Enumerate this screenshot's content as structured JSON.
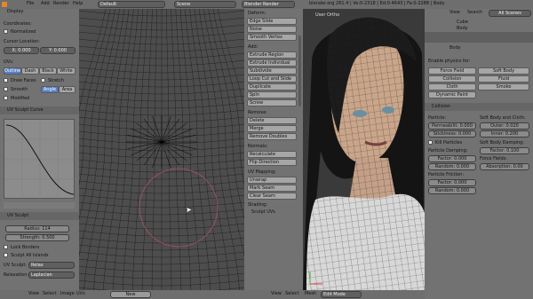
{
  "topbar": {
    "menus": [
      "File",
      "Add",
      "Render",
      "Help"
    ],
    "layout": "Default",
    "scene": "Scene",
    "engine": "Blender Render",
    "info": "blender.org 261.4 | Ve:0-2318 | Ed:0-4643 | Fa:0-2288 | Body"
  },
  "uv_editor": {
    "panel_title": "Display",
    "coordinates_label": "Coordinates:",
    "normalized_label": "Normalized",
    "cursor_location_label": "Cursor Location:",
    "cursor_x": "X: 0.000",
    "cursor_y": "Y: 0.000",
    "uvs_label": "UVs:",
    "uv_styles": [
      "Outline",
      "Dash",
      "Black",
      "White"
    ],
    "draw_faces_label": "Draw Faces",
    "stretch_label": "Stretch",
    "smooth_label": "Smooth",
    "angle_label": "Angle",
    "area_label": "Area",
    "modified_label": "Modified",
    "sculpt_curve_title": "UV Sculpt Curve",
    "uv_sculpt_title": "UV Sculpt",
    "radius_label": "Radius: 114",
    "strength_label": "Strength: 0.500",
    "lock_borders_label": "Lock Borders",
    "sculpt_all_islands_label": "Sculpt All Islands",
    "uv_sculpt_tool_label": "UV Sculpt:",
    "uv_sculpt_tool_value": "Relax",
    "relaxation_label": "Relaxation:",
    "relaxation_value": "Laplacian",
    "footer_menus": [
      "View",
      "Select",
      "Image",
      "UVs"
    ],
    "image_name": "New"
  },
  "tools": {
    "deform_title": "Deform:",
    "deform": [
      "Edge Slide",
      "Noise",
      "Smooth Vertex"
    ],
    "add_title": "Add:",
    "add": [
      "Extrude Region",
      "Extrude Individual",
      "Subdivide",
      "Loop Cut and Slide",
      "Duplicate",
      "Spin",
      "Screw"
    ],
    "remove_title": "Remove:",
    "remove": [
      "Delete",
      "Merge",
      "Remove Doubles"
    ],
    "normals_title": "Normals:",
    "normals": [
      "Recalculate",
      "Flip Direction"
    ],
    "uv_mapping_title": "UV Mapping:",
    "uv_mapping": [
      "Unwrap",
      "Mark Seam",
      "Clear Seam"
    ],
    "shading_title": "Shading:",
    "sculpt_uvs_label": "Sculpt UVs"
  },
  "viewport": {
    "label": "User Ortho",
    "footer_menus": [
      "View",
      "Select",
      "Mesh"
    ],
    "mode": "Edit Mode"
  },
  "outliner": {
    "menus": [
      "View",
      "Search"
    ],
    "filter": "All Scenes",
    "items": [
      "Cube",
      "Body"
    ]
  },
  "physics": {
    "object_name": "Body",
    "enable_label": "Enable physics for:",
    "buttons": [
      "Force Field",
      "Soft Body",
      "Collision",
      "Fluid",
      "Cloth",
      "Smoke",
      "Dynamic Paint"
    ],
    "collision_title": "Collision",
    "particle_label": "Particle:",
    "permeability": "Permeabilit: 0.000",
    "stickiness": "Stickiness: 0.000",
    "kill_particles": "Kill Particles",
    "particle_damping": "Particle Damping:",
    "pd_factor": "Factor: 0.000",
    "pd_random": "Random: 0.000",
    "particle_friction": "Particle Friction:",
    "pf_factor": "Factor: 0.000",
    "pf_random": "Random: 0.000",
    "soft_body_cloth": "Soft Body and Cloth:",
    "outer": "Outer: 0.020",
    "inner": "Inner: 0.200",
    "soft_body_damping": "Soft Body Damping:",
    "sbd_factor": "Factor: 0.100",
    "force_fields": "Force Fields:",
    "absorption": "Absorption: 0.00"
  }
}
